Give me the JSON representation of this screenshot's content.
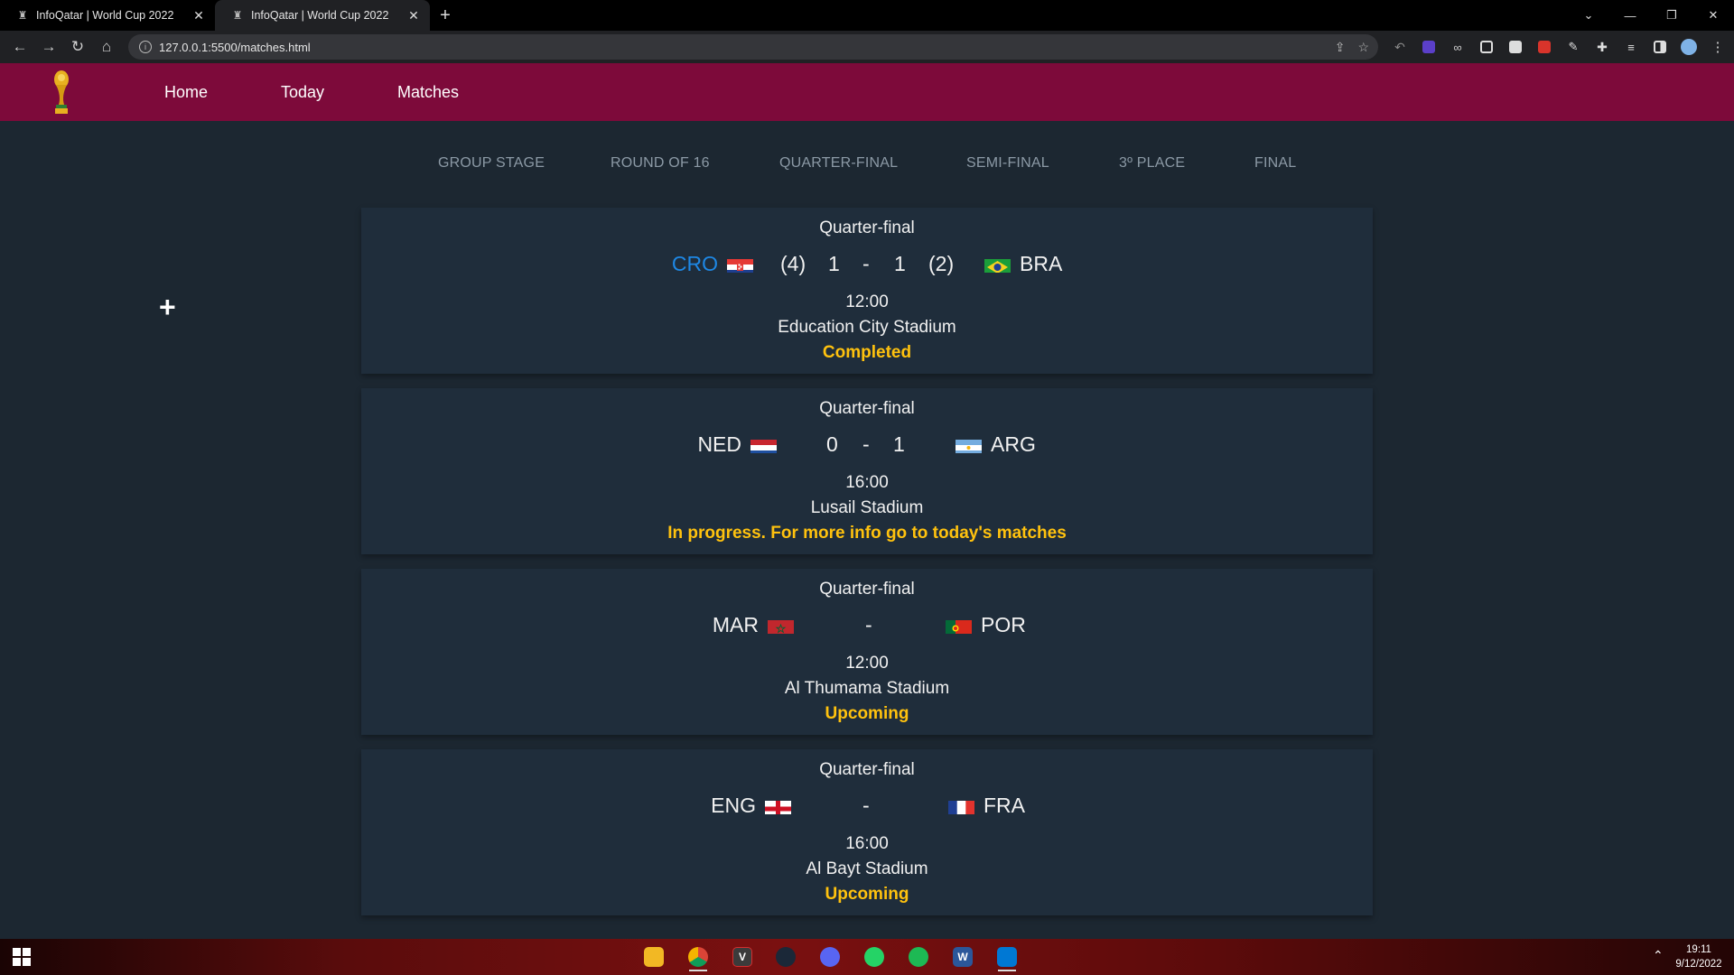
{
  "browser": {
    "tabs": [
      {
        "title": "InfoQatar | World Cup 2022",
        "active": false
      },
      {
        "title": "InfoQatar | World Cup 2022",
        "active": true
      }
    ],
    "url": "127.0.0.1:5500/matches.html",
    "new_tab_label": "+",
    "window_controls": {
      "chevron": "⌄",
      "minimize": "—",
      "restore": "❐",
      "close": "✕"
    }
  },
  "site": {
    "nav": {
      "home": "Home",
      "today": "Today",
      "matches": "Matches"
    },
    "stages": [
      "GROUP STAGE",
      "ROUND OF 16",
      "QUARTER-FINAL",
      "SEMI-FINAL",
      "3º PLACE",
      "FINAL"
    ],
    "matches": [
      {
        "round": "Quarter-final",
        "home": "CRO",
        "home_flag": "croatia-flag",
        "home_penalties": "(4)",
        "home_score": "1",
        "separator": "-",
        "away_score": "1",
        "away_penalties": "(2)",
        "away": "BRA",
        "away_flag": "brazil-flag",
        "winner": "home",
        "time": "12:00",
        "stadium": "Education City Stadium",
        "status": "Completed"
      },
      {
        "round": "Quarter-final",
        "home": "NED",
        "home_flag": "netherlands-flag",
        "home_score": "0",
        "separator": "-",
        "away_score": "1",
        "away": "ARG",
        "away_flag": "argentina-flag",
        "time": "16:00",
        "stadium": "Lusail Stadium",
        "status": "In progress. For more info go to today's matches"
      },
      {
        "round": "Quarter-final",
        "home": "MAR",
        "home_flag": "morocco-flag",
        "separator": "-",
        "away": "POR",
        "away_flag": "portugal-flag",
        "time": "12:00",
        "stadium": "Al Thumama Stadium",
        "status": "Upcoming"
      },
      {
        "round": "Quarter-final",
        "home": "ENG",
        "home_flag": "england-flag",
        "separator": "-",
        "away": "FRA",
        "away_flag": "france-flag",
        "time": "16:00",
        "stadium": "Al Bayt Stadium",
        "status": "Upcoming"
      }
    ]
  },
  "colors": {
    "header": "#7d0a3a",
    "page_bg": "#1c2731",
    "card_bg": "#1f2d3b",
    "status": "#ffc20e",
    "winner": "#1e88e5"
  },
  "taskbar": {
    "apps": [
      "file-explorer-icon",
      "chrome-icon",
      "vivaldi-icon",
      "steam-icon",
      "discord-icon",
      "whatsapp-icon",
      "spotify-icon",
      "word-icon",
      "vscode-icon"
    ],
    "time": "19:11",
    "date": "9/12/2022"
  }
}
